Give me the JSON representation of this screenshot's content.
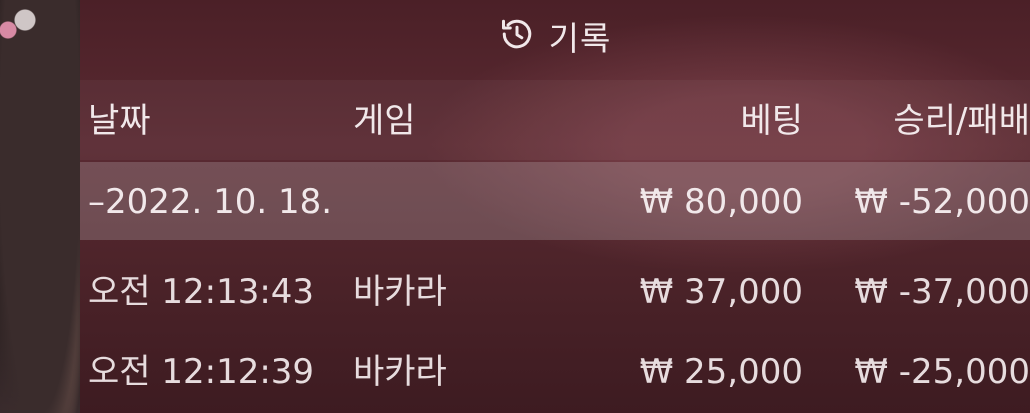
{
  "header": {
    "title": "기록",
    "icon": "history-icon"
  },
  "columns": {
    "date": "날짜",
    "game": "게임",
    "bet": "베팅",
    "result": "승리/패배"
  },
  "summary": {
    "date": "–2022. 10. 18.",
    "bet": "₩ 80,000",
    "result": "₩ -52,000"
  },
  "rows": [
    {
      "time": "오전 12:13:43",
      "game": "바카라",
      "bet": "₩ 37,000",
      "result": "₩ -37,000"
    },
    {
      "time": "오전 12:12:39",
      "game": "바카라",
      "bet": "₩ 25,000",
      "result": "₩ -25,000"
    }
  ],
  "colors": {
    "panel": "#4b2027",
    "summary_row": "#7a5e63",
    "text": "#f1e8ea"
  }
}
